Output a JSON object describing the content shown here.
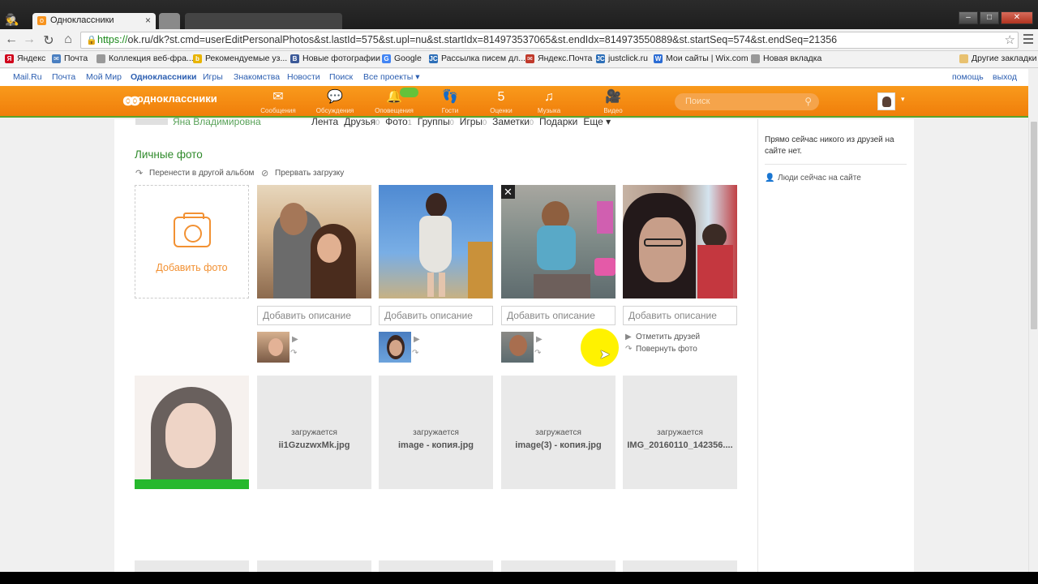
{
  "browser": {
    "tab_title": "Одноклассники",
    "tab_close": "×",
    "url_scheme": "https://",
    "url_rest": "ok.ru/dk?st.cmd=userEditPersonalPhotos&st.lastId=575&st.upl=nu&st.startIdx=814973537065&st.endIdx=814973550889&st.startSeq=574&st.endSeq=21356",
    "bookmarks": [
      {
        "label": "Яндекс",
        "color": "#d0021b",
        "glyph": "Я"
      },
      {
        "label": "Почта",
        "color": "#4a7fc1",
        "glyph": "✉"
      },
      {
        "label": "Коллекция веб-фра...",
        "color": "#999999",
        "glyph": ""
      },
      {
        "label": "Рекомендуемые уз...",
        "color": "#e8b400",
        "glyph": "b"
      },
      {
        "label": "Новые фотографии",
        "color": "#3b5998",
        "glyph": "B"
      },
      {
        "label": "Google",
        "color": "#4285f4",
        "glyph": "G"
      },
      {
        "label": "Рассылка писем дл...",
        "color": "#2d6fb8",
        "glyph": "JC"
      },
      {
        "label": "Яндекс.Почта",
        "color": "#c0392b",
        "glyph": "✉"
      },
      {
        "label": "justclick.ru",
        "color": "#2d6fb8",
        "glyph": "JC"
      },
      {
        "label": "Мои сайты | Wix.com",
        "color": "#2b6cd4",
        "glyph": "W"
      },
      {
        "label": "Новая вкладка",
        "color": "#999999",
        "glyph": ""
      }
    ],
    "other_bookmarks": "Другие закладки"
  },
  "portal": {
    "links": [
      "Mail.Ru",
      "Почта",
      "Мой Мир",
      "Одноклассники",
      "Игры",
      "Знакомства",
      "Новости",
      "Поиск",
      "Все проекты ▾"
    ],
    "help": "помощь",
    "logout": "выход"
  },
  "ok": {
    "logo": "одноклассники",
    "logo_glyph": "ꙭ",
    "nav": [
      {
        "label": "Сообщения",
        "icon": "✉"
      },
      {
        "label": "Обсуждения",
        "icon": "💬"
      },
      {
        "label": "Оповещения",
        "icon": "🔔"
      },
      {
        "label": "Гости",
        "icon": "👣"
      },
      {
        "label": "Оценки",
        "icon": "5"
      },
      {
        "label": "Музыка",
        "icon": "♫"
      },
      {
        "label": "Видео",
        "icon": "🎥"
      }
    ],
    "search_placeholder": "Поиск",
    "avatar_caret": "▾"
  },
  "profile": {
    "name": "Яна Владимировна",
    "nav": [
      {
        "label": "Лента",
        "count": ""
      },
      {
        "label": "Друзья",
        "count": "0"
      },
      {
        "label": "Фото",
        "count": "1"
      },
      {
        "label": "Группы",
        "count": "0"
      },
      {
        "label": "Игры",
        "count": "0"
      },
      {
        "label": "Заметки",
        "count": "0"
      },
      {
        "label": "Подарки",
        "count": ""
      },
      {
        "label": "Еще ▾",
        "count": ""
      }
    ]
  },
  "album": {
    "title": "Личные фото",
    "move_action": "Перенести в другой альбом",
    "cancel_action": "Прервать загрузку",
    "add_photo": "Добавить фото",
    "description_placeholder": "Добавить описание",
    "tag_friends": "Отметить друзей",
    "rotate_photo": "Повернуть фото",
    "close_glyph": "✕",
    "uploading": [
      {
        "status": "загружается",
        "filename": "ii1GzuzwxMk.jpg"
      },
      {
        "status": "загружается",
        "filename": "image - копия.jpg"
      },
      {
        "status": "загружается",
        "filename": "image(3) - копия.jpg"
      },
      {
        "status": "загружается",
        "filename": "IMG_20160110_142356...."
      }
    ]
  },
  "sidebar": {
    "no_friends": "Прямо сейчас никого из друзей на сайте нет.",
    "people_online": "Люди сейчас на сайте"
  },
  "colors": {
    "ok_orange": "#f7931e",
    "ok_green": "#2f8a2b",
    "upload_green": "#26b82d"
  }
}
